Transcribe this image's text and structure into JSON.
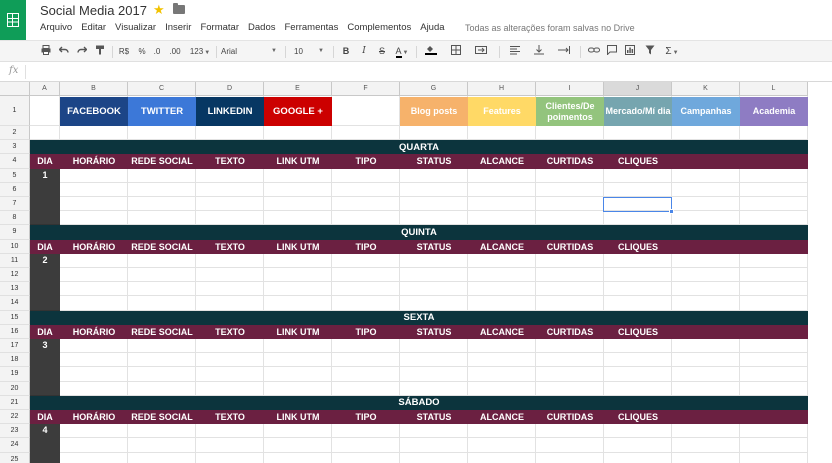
{
  "app": {
    "title": "Social Media 2017",
    "save_status": "Todas as alterações foram salvas no Drive",
    "menu": [
      "Arquivo",
      "Editar",
      "Visualizar",
      "Inserir",
      "Formatar",
      "Dados",
      "Ferramentas",
      "Complementos",
      "Ajuda"
    ]
  },
  "toolbar": {
    "currency": "R$",
    "percent": "%",
    "dec_decrease": ".0",
    "dec_increase": ".00",
    "more_formats": "123",
    "font": "Arial",
    "font_size": "10",
    "bold": "B",
    "italic": "I",
    "strike": "S",
    "text_color": "A",
    "function": "Σ"
  },
  "formula_bar": {
    "fx": "fx",
    "value": ""
  },
  "grid": {
    "columns": [
      "A",
      "B",
      "C",
      "D",
      "E",
      "F",
      "G",
      "H",
      "I",
      "J",
      "K",
      "L"
    ],
    "selected_column": "J",
    "selected_cell": "J7",
    "rows": [
      "1",
      "2",
      "3",
      "4",
      "5",
      "6",
      "7",
      "8",
      "9",
      "10",
      "11",
      "12",
      "13",
      "14",
      "15",
      "16",
      "17",
      "18",
      "19",
      "20",
      "21",
      "22",
      "23",
      "24",
      "25"
    ]
  },
  "social_buttons": [
    {
      "label": "FACEBOOK",
      "color": "#1c4587",
      "col": "B"
    },
    {
      "label": "TWITTER",
      "color": "#3c78d8",
      "col": "C"
    },
    {
      "label": "LINKEDIN",
      "color": "#073763",
      "col": "D"
    },
    {
      "label": "GOOGLE +",
      "color": "#cc0000",
      "col": "E"
    }
  ],
  "category_buttons": [
    {
      "label": "Blog posts",
      "color": "#f6b26b",
      "col": "G"
    },
    {
      "label": "Features",
      "color": "#ffd966",
      "col": "H"
    },
    {
      "label": "Clientes/De poimentos",
      "color": "#93c47d",
      "col": "I"
    },
    {
      "label": "Mercado/Mí dia",
      "color": "#76a5af",
      "col": "J"
    },
    {
      "label": "Campanhas",
      "color": "#6fa8dc",
      "col": "K"
    },
    {
      "label": "Academia",
      "color": "#8e7cc3",
      "col": "L"
    }
  ],
  "table_headers": [
    "DIA",
    "HORÁRIO",
    "REDE SOCIAL",
    "TEXTO",
    "LINK UTM",
    "TIPO",
    "STATUS",
    "ALCANCE",
    "CURTIDAS",
    "CLIQUES"
  ],
  "days": [
    {
      "name": "QUARTA",
      "number": "1"
    },
    {
      "name": "QUINTA",
      "number": "2"
    },
    {
      "name": "SEXTA",
      "number": "3"
    },
    {
      "name": "SÁBADO",
      "number": "4"
    }
  ]
}
